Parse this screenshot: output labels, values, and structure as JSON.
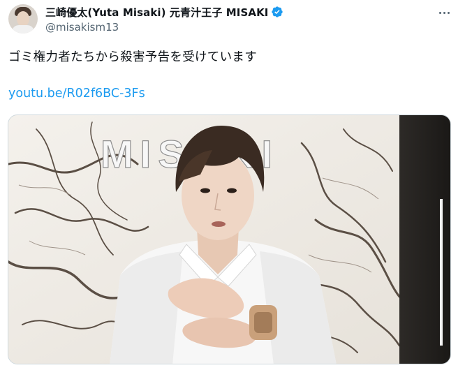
{
  "author": {
    "display_name": "三崎優太(Yuta Misaki) 元青汁王子 MISAKI",
    "handle": "@misakism13",
    "verified": true,
    "avatar_icon": "avatar-photo"
  },
  "tweet": {
    "text": "ゴミ権力者たちから殺害予告を受けています",
    "link": "youtu.be/R02f6BC-3Fs"
  },
  "media": {
    "sign_text": "MISAKI",
    "type": "photo"
  },
  "colors": {
    "link": "#1d9bf0",
    "verified": "#1d9bf0",
    "secondary_text": "#536471"
  }
}
